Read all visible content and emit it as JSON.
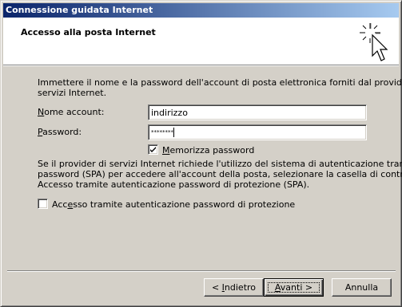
{
  "window": {
    "title": "Connessione guidata Internet"
  },
  "header": {
    "heading": "Accesso alla posta Internet",
    "icon": "wizard-cursor-icon"
  },
  "intro": {
    "line1": "Immettere il nome e la password dell'account di posta elettronica forniti dal provider di",
    "line2": "servizi Internet."
  },
  "fields": {
    "account_name": {
      "label_accel": "N",
      "label_rest": "ome account:",
      "value": "indirizzo"
    },
    "password": {
      "label_accel": "P",
      "label_rest": "assword:",
      "masked_value": "********"
    }
  },
  "remember_password": {
    "label_accel": "M",
    "label_rest": "emorizza password",
    "checked": true
  },
  "spa_info": {
    "line1": "Se il provider di servizi Internet richiede l'utilizzo del sistema di autenticazione tramite",
    "line2": "password (SPA) per accedere all'account della posta, selezionare la casella di controllo",
    "line3": "Accesso tramite autenticazione password di protezione (SPA)."
  },
  "spa_checkbox": {
    "label_pre": "Acc",
    "label_accel": "e",
    "label_rest": "sso tramite autenticazione password di protezione",
    "checked": false
  },
  "buttons": {
    "back": {
      "prefix": "< ",
      "accel": "I",
      "rest": "ndietro"
    },
    "next": {
      "accel": "A",
      "rest": "vanti >"
    },
    "cancel": {
      "label": "Annulla"
    }
  }
}
